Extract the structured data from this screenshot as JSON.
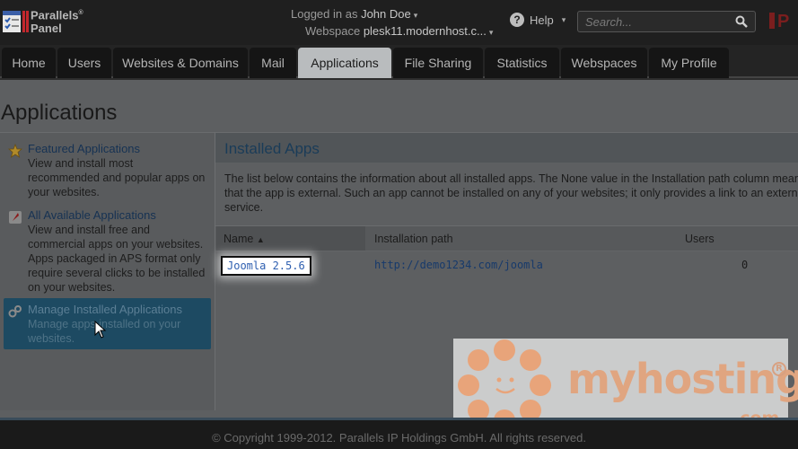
{
  "header": {
    "brand_line1": "Parallels",
    "brand_reg": "®",
    "brand_line2": "Panel",
    "logged_in_label": "Logged in as",
    "user_name": "John Doe",
    "webspace_label": "Webspace",
    "webspace_value": "plesk11.modernhost.c...",
    "help_label": "Help",
    "search_placeholder": "Search...",
    "brand_mark": "P"
  },
  "nav": {
    "tabs": [
      {
        "label": "Home"
      },
      {
        "label": "Users"
      },
      {
        "label": "Websites & Domains"
      },
      {
        "label": "Mail"
      },
      {
        "label": "Applications",
        "active": true
      },
      {
        "label": "File Sharing"
      },
      {
        "label": "Statistics"
      },
      {
        "label": "Webspaces"
      },
      {
        "label": "My Profile"
      }
    ]
  },
  "page": {
    "title": "Applications"
  },
  "sidebar": {
    "items": [
      {
        "title": "Featured Applications",
        "desc": "View and install most recommended and popular apps on your websites.",
        "icon": "star-icon"
      },
      {
        "title": "All Available Applications",
        "desc": "View and install free and commercial apps on your websites. Apps packaged in APS format only require several clicks to be installed on your websites.",
        "icon": "app-catalog-icon"
      },
      {
        "title": "Manage Installed Applications",
        "desc": "Manage apps installed on your websites.",
        "icon": "gears-icon",
        "active": true
      }
    ]
  },
  "panel": {
    "title": "Installed Apps",
    "desc_line1": "The list below contains the information about all installed apps. The None value in the Installation path column means",
    "desc_line2": "that the app is external. Such an app cannot be installed on any of your websites; it only provides a link to an external",
    "desc_line3": "service.",
    "columns": {
      "name": "Name",
      "sort_indicator": "▲",
      "path": "Installation path",
      "users": "Users"
    },
    "rows": [
      {
        "name": "Joomla 2.5.6",
        "path": "http://demo1234.com/joomla",
        "users": "0"
      }
    ]
  },
  "watermark": {
    "text": "myhosting",
    "suffix": ".com",
    "reg": "R"
  },
  "footer": {
    "copyright": "© Copyright 1999-2012. Parallels IP Holdings GmbH. All rights reserved."
  },
  "colors": {
    "accent": "#1d4a62",
    "link": "#2e5fb0",
    "watermark": "#e0a580"
  }
}
